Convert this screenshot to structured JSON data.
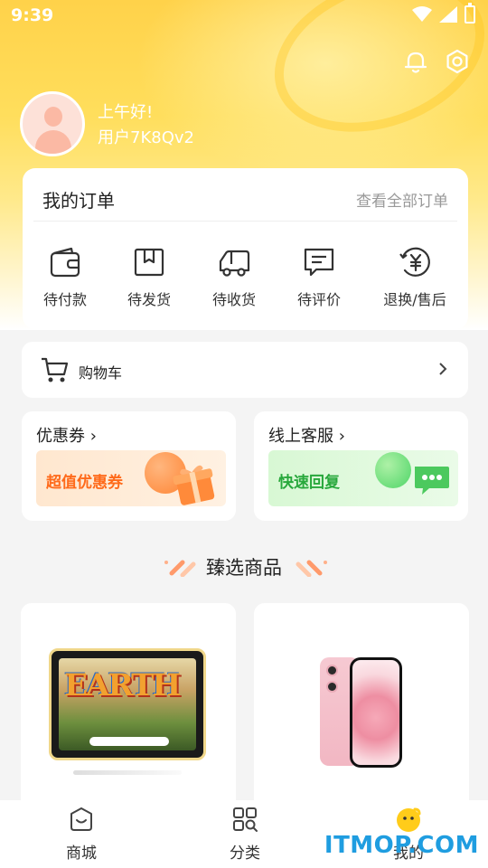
{
  "status_bar": {
    "time": "9:39"
  },
  "profile": {
    "greeting": "上午好!",
    "username": "用户7K8Qv2"
  },
  "orders": {
    "title": "我的订单",
    "view_all": "查看全部订单",
    "items": [
      {
        "label": "待付款",
        "icon": "wallet-icon"
      },
      {
        "label": "待发货",
        "icon": "package-icon"
      },
      {
        "label": "待收货",
        "icon": "truck-icon"
      },
      {
        "label": "待评价",
        "icon": "comment-icon"
      },
      {
        "label": "退换/售后",
        "icon": "refund-icon"
      }
    ]
  },
  "cart": {
    "label": "购物车"
  },
  "promos": {
    "coupon": {
      "title": "优惠券",
      "banner": "超值优惠券"
    },
    "service": {
      "title": "线上客服",
      "banner": "快速回复"
    }
  },
  "section": {
    "title": "臻选商品"
  },
  "nav": {
    "items": [
      {
        "label": "商城",
        "icon": "shop-bag-icon"
      },
      {
        "label": "分类",
        "icon": "category-grid-icon"
      },
      {
        "label": "我的",
        "icon": "profile-face-icon"
      }
    ]
  },
  "watermark": "ITMOP.COM",
  "colors": {
    "accent": "#ffd24a",
    "coupon": "#ff6a1a",
    "service": "#28a83c",
    "watermark": "#1f9de0"
  }
}
